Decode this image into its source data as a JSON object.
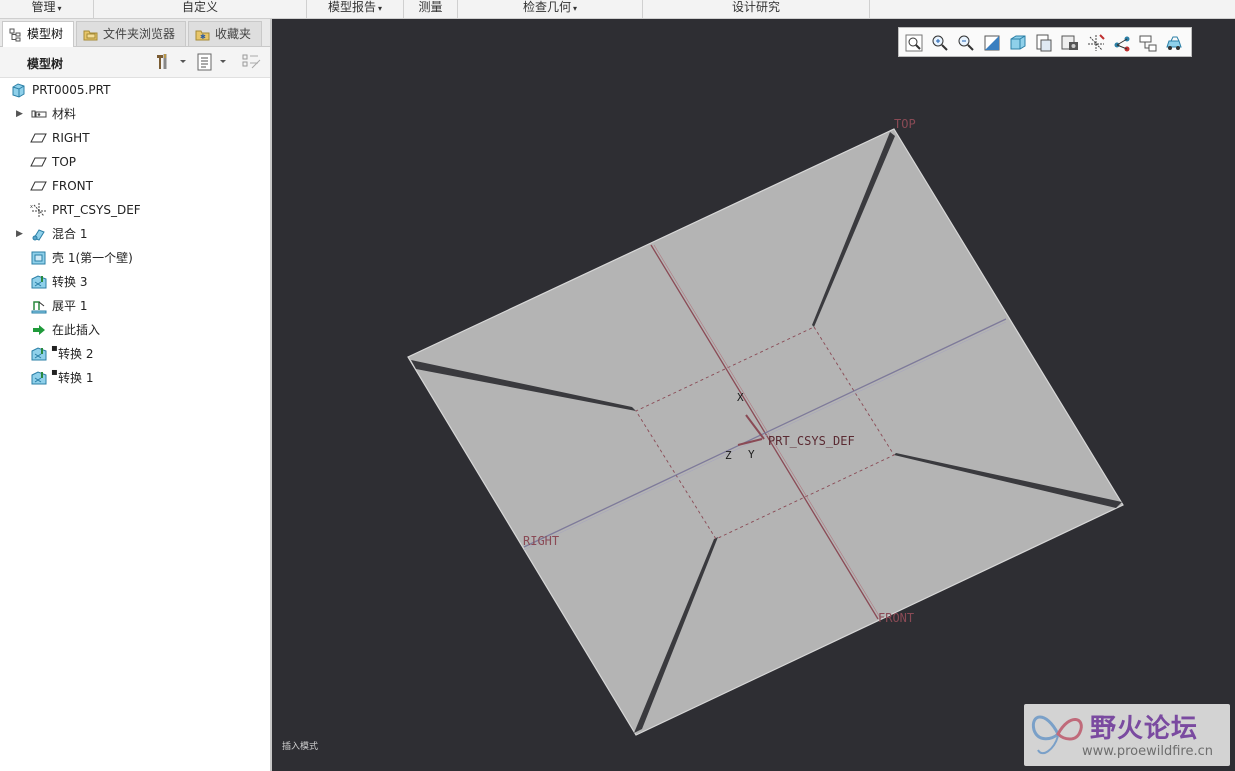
{
  "ribbon": {
    "groups": [
      {
        "label": "管理",
        "caret": "▾"
      },
      {
        "label": "自定义",
        "caret": ""
      },
      {
        "label": "模型报告",
        "caret": "▾"
      },
      {
        "label": "测量",
        "caret": ""
      },
      {
        "label": "检查几何",
        "caret": "▾"
      },
      {
        "label": "设计研究",
        "caret": ""
      }
    ]
  },
  "tabs": [
    {
      "label": "模型树",
      "icon": "model-tree-icon",
      "active": true
    },
    {
      "label": "文件夹浏览器",
      "icon": "folder-browser-icon",
      "active": false
    },
    {
      "label": "收藏夹",
      "icon": "favorites-icon",
      "active": false
    }
  ],
  "tree_header": {
    "title": "模型树"
  },
  "tree": {
    "items": [
      {
        "label": "PRT0005.PRT",
        "icon": "part-icon",
        "expandable": false
      },
      {
        "label": "材料",
        "icon": "material-icon",
        "expandable": true
      },
      {
        "label": "RIGHT",
        "icon": "datum-plane-icon",
        "expandable": false
      },
      {
        "label": "TOP",
        "icon": "datum-plane-icon",
        "expandable": false
      },
      {
        "label": "FRONT",
        "icon": "datum-plane-icon",
        "expandable": false
      },
      {
        "label": "PRT_CSYS_DEF",
        "icon": "csys-icon",
        "expandable": false
      },
      {
        "label": "混合 1",
        "icon": "blend-icon",
        "expandable": true
      },
      {
        "label": "壳 1(第一个壁)",
        "icon": "shell-icon",
        "expandable": false
      },
      {
        "label": "转换 3",
        "icon": "conversion-icon",
        "expandable": false
      },
      {
        "label": "展平 1",
        "icon": "flatten-icon",
        "expandable": false
      },
      {
        "label": "在此插入",
        "icon": "insert-here-icon",
        "expandable": false
      },
      {
        "label": "转换 2",
        "icon": "conversion-icon",
        "expandable": false
      },
      {
        "label": "转换 1",
        "icon": "conversion-icon",
        "expandable": false
      }
    ]
  },
  "viewport": {
    "datum_labels": {
      "top": "TOP",
      "right": "RIGHT",
      "front": "FRONT",
      "csys": "PRT_CSYS_DEF"
    },
    "axis_labels": {
      "x": "X",
      "y": "Y",
      "z": "Z"
    },
    "status_text": "插入模式",
    "toolbar_icons": [
      "refit-icon",
      "zoom-in-icon",
      "zoom-out-icon",
      "repaint-icon",
      "display-style-icon",
      "saved-views-icon",
      "view-manager-icon",
      "datum-display-icon",
      "spin-center-icon",
      "annotation-display-icon",
      "perspective-icon"
    ]
  },
  "watermark": {
    "title": "野火论坛",
    "url": "www.proewildfire.cn"
  },
  "colors": {
    "datum": "#8a4a55",
    "part": "#b4b4b4",
    "background": "#2e2e33"
  }
}
